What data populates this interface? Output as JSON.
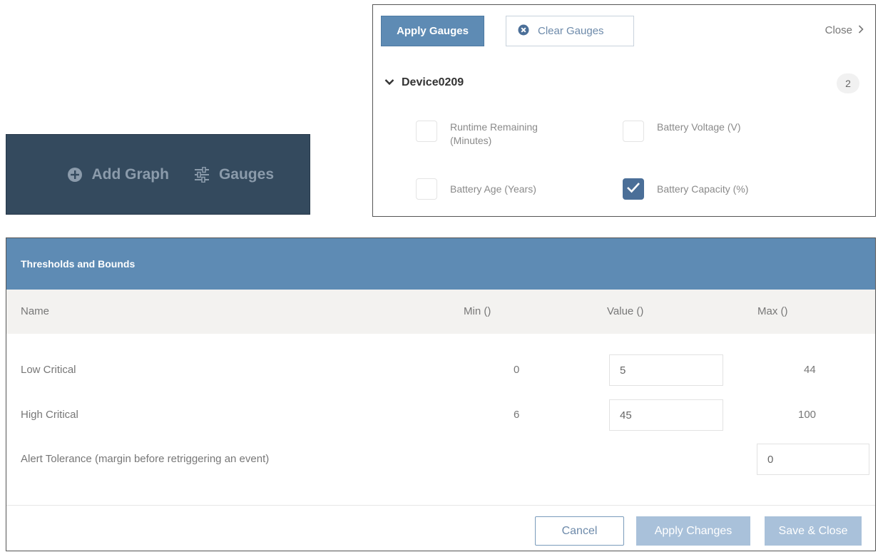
{
  "toolbar": {
    "add_graph_label": "Add Graph",
    "gauges_label": "Gauges",
    "icon_color": "#8b9bab",
    "background": "#344a5e"
  },
  "gauges_panel": {
    "apply_label": "Apply Gauges",
    "clear_label": "Clear Gauges",
    "close_label": "Close",
    "device_name": "Device0209",
    "device_count": "2",
    "options": [
      {
        "label": "Runtime Remaining (Minutes)",
        "checked": false
      },
      {
        "label": "Battery Voltage (V)",
        "checked": false
      },
      {
        "label": "Battery Age (Years)",
        "checked": false
      },
      {
        "label": "Battery Capacity (%)",
        "checked": true
      }
    ],
    "accent_color": "#5e8bb4"
  },
  "thresholds": {
    "title": "Thresholds and Bounds",
    "columns": {
      "name": "Name",
      "min": "Min ()",
      "value": "Value ()",
      "max": "Max ()"
    },
    "rows": [
      {
        "name": "Low Critical",
        "min": "0",
        "value": "5",
        "max": "44"
      },
      {
        "name": "High Critical",
        "min": "6",
        "value": "45",
        "max": "100"
      }
    ],
    "tolerance": {
      "label": "Alert Tolerance (margin before retriggering an event)",
      "value": "0"
    },
    "buttons": {
      "cancel": "Cancel",
      "apply": "Apply Changes",
      "save_close": "Save & Close"
    }
  }
}
